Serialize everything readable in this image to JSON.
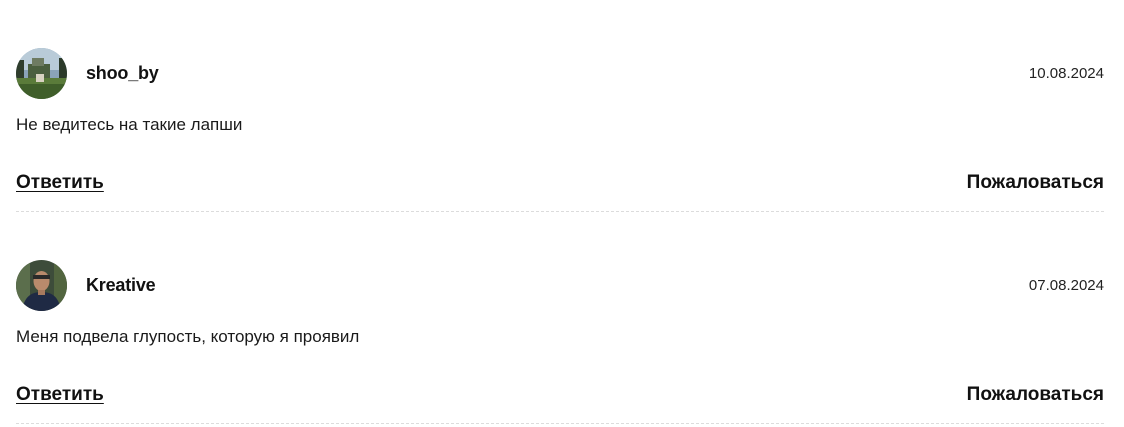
{
  "comments": [
    {
      "author": "shoo_by",
      "date": "10.08.2024",
      "text": "Не ведитесь на такие лапши",
      "reply_label": "Ответить",
      "report_label": "Пожаловаться"
    },
    {
      "author": "Kreative",
      "date": "07.08.2024",
      "text": "Меня подвела глупость, которую я проявил",
      "reply_label": "Ответить",
      "report_label": "Пожаловаться"
    }
  ]
}
